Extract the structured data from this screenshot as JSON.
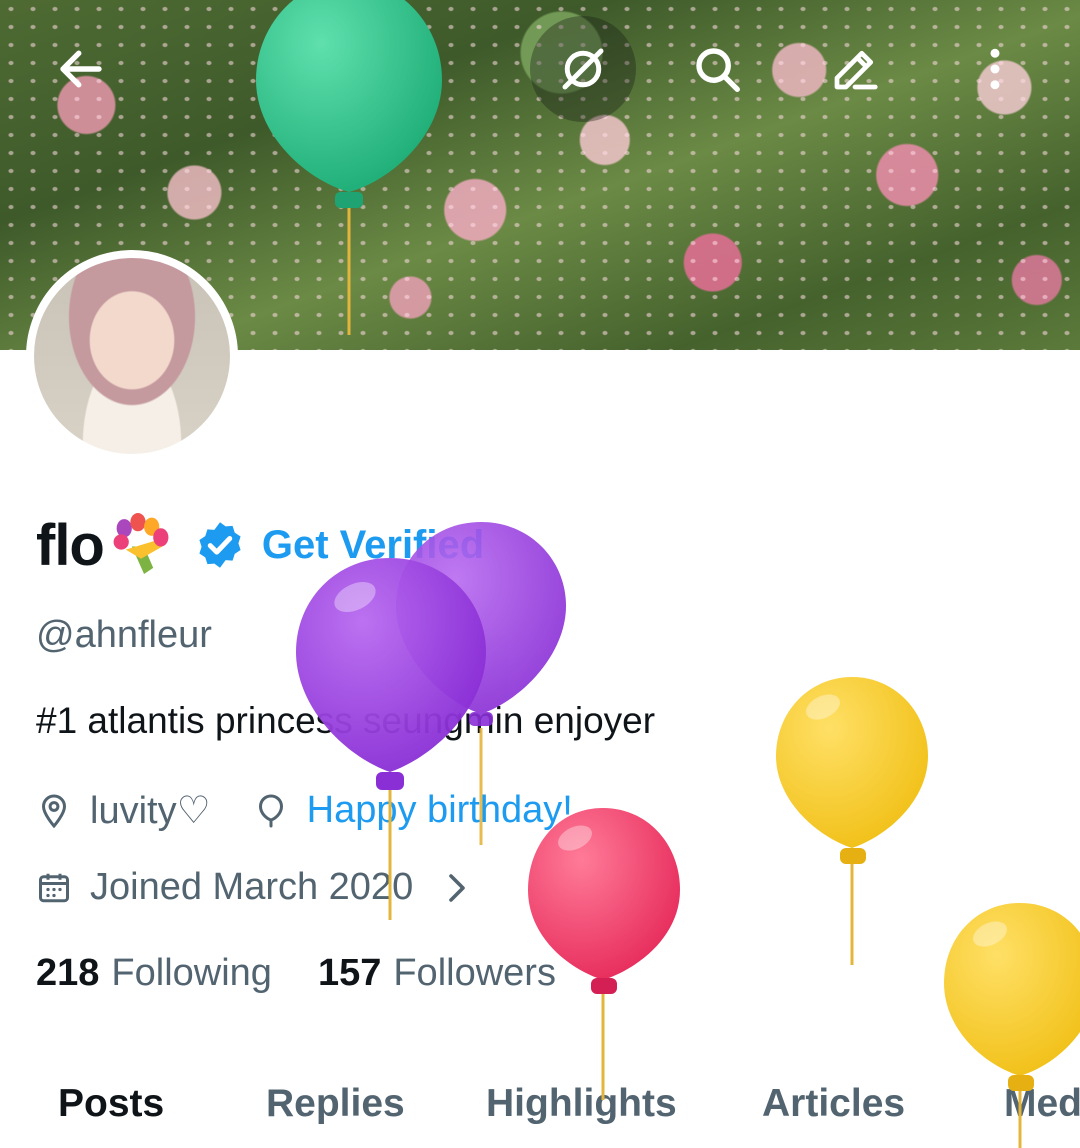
{
  "profile": {
    "display_name": "flo",
    "get_verified": "Get Verified",
    "handle": "@ahnfleur",
    "bio": "#1 atlantis princess seungmin enjoyer",
    "location": "luvity♡",
    "birthday": "Happy birthday!",
    "joined": "Joined March 2020"
  },
  "stats": {
    "following_count": "218",
    "following_label": "Following",
    "followers_count": "157",
    "followers_label": "Followers"
  },
  "tabs": [
    {
      "label": "Posts",
      "active": true
    },
    {
      "label": "Replies"
    },
    {
      "label": "Highlights"
    },
    {
      "label": "Articles"
    },
    {
      "label": "Media"
    }
  ],
  "top_bar": {
    "icons": [
      "back-arrow-icon",
      "grok-icon",
      "search-icon",
      "edit-icon",
      "more-icon"
    ]
  },
  "colors": {
    "accent": "#1d9bf0",
    "text_primary": "#0f1419",
    "text_secondary": "#536471",
    "balloon_green": "#34c98f",
    "balloon_purple": "#9b3ee0",
    "balloon_pink": "#f0406e",
    "balloon_yellow": "#f7ce2e"
  }
}
